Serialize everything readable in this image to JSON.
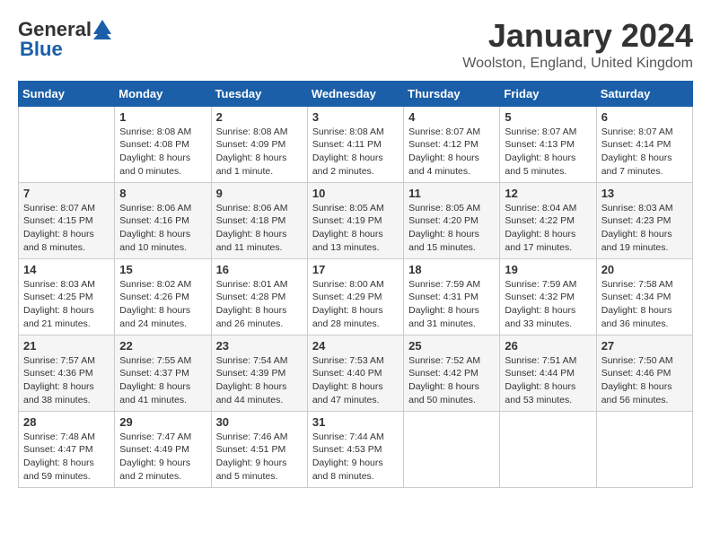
{
  "header": {
    "logo_general": "General",
    "logo_blue": "Blue",
    "month_title": "January 2024",
    "location": "Woolston, England, United Kingdom"
  },
  "days_of_week": [
    "Sunday",
    "Monday",
    "Tuesday",
    "Wednesday",
    "Thursday",
    "Friday",
    "Saturday"
  ],
  "weeks": [
    [
      {
        "day": "",
        "info": ""
      },
      {
        "day": "1",
        "info": "Sunrise: 8:08 AM\nSunset: 4:08 PM\nDaylight: 8 hours\nand 0 minutes."
      },
      {
        "day": "2",
        "info": "Sunrise: 8:08 AM\nSunset: 4:09 PM\nDaylight: 8 hours\nand 1 minute."
      },
      {
        "day": "3",
        "info": "Sunrise: 8:08 AM\nSunset: 4:11 PM\nDaylight: 8 hours\nand 2 minutes."
      },
      {
        "day": "4",
        "info": "Sunrise: 8:07 AM\nSunset: 4:12 PM\nDaylight: 8 hours\nand 4 minutes."
      },
      {
        "day": "5",
        "info": "Sunrise: 8:07 AM\nSunset: 4:13 PM\nDaylight: 8 hours\nand 5 minutes."
      },
      {
        "day": "6",
        "info": "Sunrise: 8:07 AM\nSunset: 4:14 PM\nDaylight: 8 hours\nand 7 minutes."
      }
    ],
    [
      {
        "day": "7",
        "info": "Sunrise: 8:07 AM\nSunset: 4:15 PM\nDaylight: 8 hours\nand 8 minutes."
      },
      {
        "day": "8",
        "info": "Sunrise: 8:06 AM\nSunset: 4:16 PM\nDaylight: 8 hours\nand 10 minutes."
      },
      {
        "day": "9",
        "info": "Sunrise: 8:06 AM\nSunset: 4:18 PM\nDaylight: 8 hours\nand 11 minutes."
      },
      {
        "day": "10",
        "info": "Sunrise: 8:05 AM\nSunset: 4:19 PM\nDaylight: 8 hours\nand 13 minutes."
      },
      {
        "day": "11",
        "info": "Sunrise: 8:05 AM\nSunset: 4:20 PM\nDaylight: 8 hours\nand 15 minutes."
      },
      {
        "day": "12",
        "info": "Sunrise: 8:04 AM\nSunset: 4:22 PM\nDaylight: 8 hours\nand 17 minutes."
      },
      {
        "day": "13",
        "info": "Sunrise: 8:03 AM\nSunset: 4:23 PM\nDaylight: 8 hours\nand 19 minutes."
      }
    ],
    [
      {
        "day": "14",
        "info": "Sunrise: 8:03 AM\nSunset: 4:25 PM\nDaylight: 8 hours\nand 21 minutes."
      },
      {
        "day": "15",
        "info": "Sunrise: 8:02 AM\nSunset: 4:26 PM\nDaylight: 8 hours\nand 24 minutes."
      },
      {
        "day": "16",
        "info": "Sunrise: 8:01 AM\nSunset: 4:28 PM\nDaylight: 8 hours\nand 26 minutes."
      },
      {
        "day": "17",
        "info": "Sunrise: 8:00 AM\nSunset: 4:29 PM\nDaylight: 8 hours\nand 28 minutes."
      },
      {
        "day": "18",
        "info": "Sunrise: 7:59 AM\nSunset: 4:31 PM\nDaylight: 8 hours\nand 31 minutes."
      },
      {
        "day": "19",
        "info": "Sunrise: 7:59 AM\nSunset: 4:32 PM\nDaylight: 8 hours\nand 33 minutes."
      },
      {
        "day": "20",
        "info": "Sunrise: 7:58 AM\nSunset: 4:34 PM\nDaylight: 8 hours\nand 36 minutes."
      }
    ],
    [
      {
        "day": "21",
        "info": "Sunrise: 7:57 AM\nSunset: 4:36 PM\nDaylight: 8 hours\nand 38 minutes."
      },
      {
        "day": "22",
        "info": "Sunrise: 7:55 AM\nSunset: 4:37 PM\nDaylight: 8 hours\nand 41 minutes."
      },
      {
        "day": "23",
        "info": "Sunrise: 7:54 AM\nSunset: 4:39 PM\nDaylight: 8 hours\nand 44 minutes."
      },
      {
        "day": "24",
        "info": "Sunrise: 7:53 AM\nSunset: 4:40 PM\nDaylight: 8 hours\nand 47 minutes."
      },
      {
        "day": "25",
        "info": "Sunrise: 7:52 AM\nSunset: 4:42 PM\nDaylight: 8 hours\nand 50 minutes."
      },
      {
        "day": "26",
        "info": "Sunrise: 7:51 AM\nSunset: 4:44 PM\nDaylight: 8 hours\nand 53 minutes."
      },
      {
        "day": "27",
        "info": "Sunrise: 7:50 AM\nSunset: 4:46 PM\nDaylight: 8 hours\nand 56 minutes."
      }
    ],
    [
      {
        "day": "28",
        "info": "Sunrise: 7:48 AM\nSunset: 4:47 PM\nDaylight: 8 hours\nand 59 minutes."
      },
      {
        "day": "29",
        "info": "Sunrise: 7:47 AM\nSunset: 4:49 PM\nDaylight: 9 hours\nand 2 minutes."
      },
      {
        "day": "30",
        "info": "Sunrise: 7:46 AM\nSunset: 4:51 PM\nDaylight: 9 hours\nand 5 minutes."
      },
      {
        "day": "31",
        "info": "Sunrise: 7:44 AM\nSunset: 4:53 PM\nDaylight: 9 hours\nand 8 minutes."
      },
      {
        "day": "",
        "info": ""
      },
      {
        "day": "",
        "info": ""
      },
      {
        "day": "",
        "info": ""
      }
    ]
  ]
}
